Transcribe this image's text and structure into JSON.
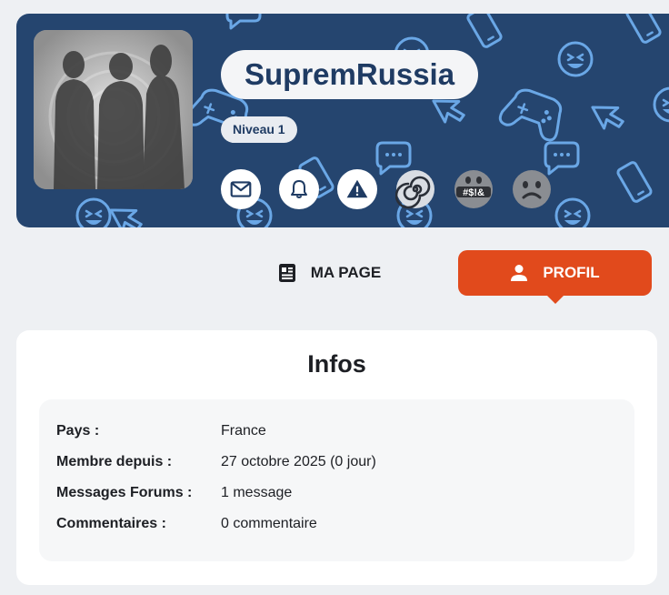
{
  "profile": {
    "username": "SupremRussia",
    "level": "Niveau 1"
  },
  "actions": [
    {
      "name": "message",
      "icon": "mail-icon"
    },
    {
      "name": "follow",
      "icon": "bell-icon"
    },
    {
      "name": "report",
      "icon": "warning-icon"
    }
  ],
  "badges": [
    {
      "icon": "spiral-icon"
    },
    {
      "icon": "censored-emoji-icon",
      "text": "#$!&"
    },
    {
      "icon": "sad-face-icon"
    }
  ],
  "tabs": {
    "mapage": {
      "label": "MA PAGE",
      "icon": "newspaper-icon"
    },
    "profil": {
      "label": "PROFIL",
      "icon": "user-icon"
    }
  },
  "infos": {
    "title": "Infos",
    "rows": [
      {
        "label": "Pays :",
        "value": "France"
      },
      {
        "label": "Membre depuis :",
        "value": "27 octobre 2025 (0 jour)"
      },
      {
        "label": "Messages Forums :",
        "value": "1 message"
      },
      {
        "label": "Commentaires :",
        "value": "0 commentaire"
      }
    ]
  },
  "colors": {
    "banner": "#25456f",
    "pattern": "#6aa7e6",
    "accent": "#e14a1c",
    "username": "#1f3b63"
  }
}
